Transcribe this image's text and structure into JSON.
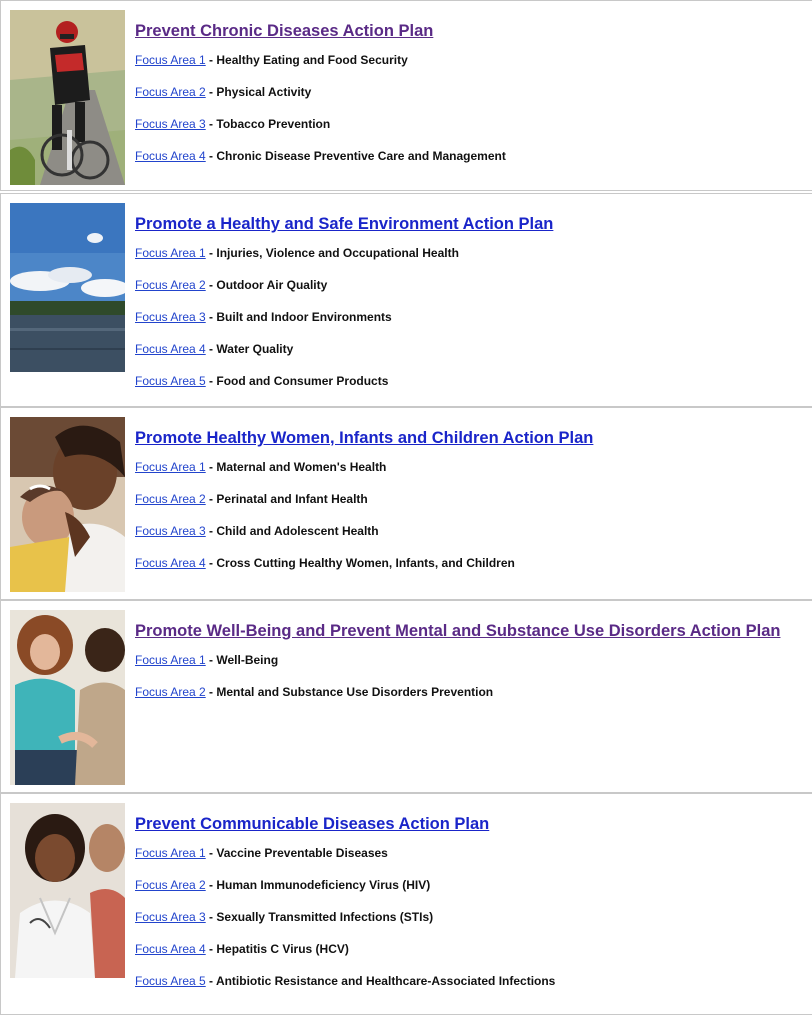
{
  "sections": [
    {
      "title": "Prevent Chronic Diseases Action Plan",
      "items": [
        {
          "link": "Focus Area 1",
          "desc": "Healthy Eating and Food Security"
        },
        {
          "link": "Focus Area 2",
          "desc": "Physical Activity"
        },
        {
          "link": "Focus Area 3",
          "desc": "Tobacco Prevention"
        },
        {
          "link": "Focus Area 4",
          "desc": "Chronic Disease Preventive Care and Management"
        }
      ]
    },
    {
      "title": "Promote a Healthy and Safe Environment Action Plan",
      "items": [
        {
          "link": "Focus Area 1",
          "desc": "Injuries, Violence and Occupational Health"
        },
        {
          "link": "Focus Area 2",
          "desc": "Outdoor Air Quality"
        },
        {
          "link": "Focus Area 3",
          "desc": "Built and Indoor Environments"
        },
        {
          "link": "Focus Area 4",
          "desc": "Water Quality"
        },
        {
          "link": "Focus Area 5",
          "desc": "Food and Consumer Products"
        }
      ]
    },
    {
      "title": "Promote Healthy Women, Infants and Children Action Plan",
      "items": [
        {
          "link": "Focus Area 1",
          "desc": "Maternal and Women's Health"
        },
        {
          "link": "Focus Area 2",
          "desc": "Perinatal and Infant Health"
        },
        {
          "link": "Focus Area 3",
          "desc": "Child and Adolescent Health"
        },
        {
          "link": "Focus Area 4",
          "desc": "Cross Cutting Healthy Women, Infants, and Children"
        }
      ]
    },
    {
      "title": "Promote Well-Being and Prevent Mental and Substance Use Disorders Action Plan",
      "items": [
        {
          "link": "Focus Area 1",
          "desc": "Well-Being"
        },
        {
          "link": "Focus Area 2",
          "desc": "Mental and Substance Use Disorders Prevention"
        }
      ]
    },
    {
      "title": "Prevent Communicable Diseases Action Plan",
      "items": [
        {
          "link": "Focus Area 1",
          "desc": "Vaccine Preventable Diseases"
        },
        {
          "link": "Focus Area 2",
          "desc": "Human Immunodeficiency Virus (HIV)"
        },
        {
          "link": "Focus Area 3",
          "desc": "Sexually Transmitted Infections (STIs)"
        },
        {
          "link": "Focus Area 4",
          "desc": "Hepatitis C Virus (HCV)"
        },
        {
          "link": "Focus Area 5",
          "desc": "Antibiotic Resistance and Healthcare-Associated Infections"
        }
      ]
    }
  ],
  "separator": " - ",
  "colors": {
    "visited_link": "#5a2a86",
    "link": "#1a25c9",
    "border": "#c8c8c8"
  },
  "images": [
    "cyclist-photo",
    "lake-sky-photo",
    "mother-infant-photo",
    "counseling-photo",
    "doctor-patient-photo"
  ]
}
